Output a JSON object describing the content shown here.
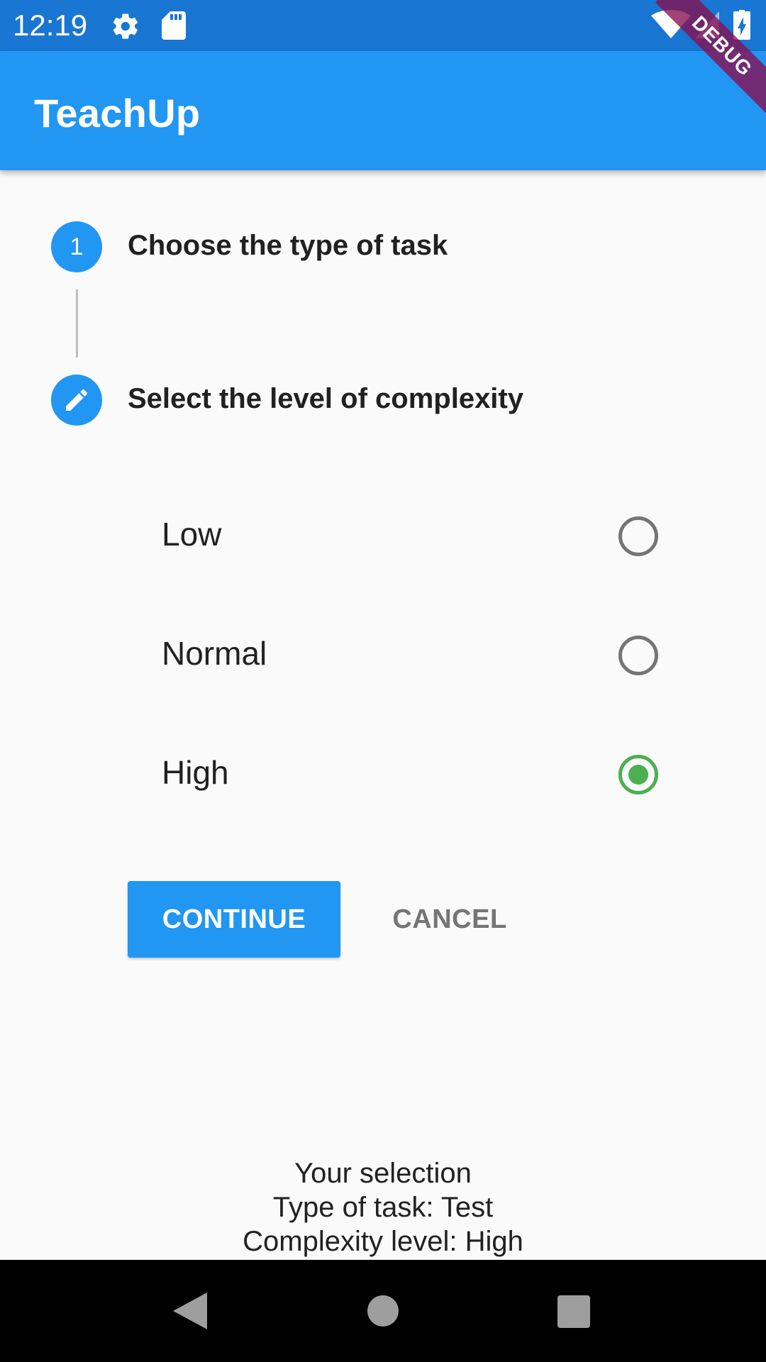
{
  "status_bar": {
    "time": "12:19",
    "icons": [
      "gear-icon",
      "sd-card-icon",
      "wifi-icon",
      "signal-icon",
      "battery-charging-icon"
    ]
  },
  "app_bar": {
    "title": "TeachUp"
  },
  "debug_banner": "DEBUG",
  "stepper": {
    "steps": [
      {
        "number": "1",
        "title": "Choose the type of task",
        "state": "complete"
      },
      {
        "icon": "edit-pencil-icon",
        "title": "Select the level of complexity",
        "state": "editing"
      }
    ],
    "options": [
      {
        "label": "Low",
        "selected": false
      },
      {
        "label": "Normal",
        "selected": false
      },
      {
        "label": "High",
        "selected": true
      }
    ],
    "continue_label": "CONTINUE",
    "cancel_label": "CANCEL"
  },
  "summary": {
    "line1": "Your selection",
    "line2": "Type of task: Test",
    "line3": "Complexity level: High"
  },
  "colors": {
    "primary": "#2196f3",
    "status_bar": "#1976d2",
    "radio_selected": "#4caf50",
    "radio_unselected": "#757575"
  },
  "nav_bar": {
    "icons": [
      "back-icon",
      "home-icon",
      "recents-icon"
    ]
  }
}
